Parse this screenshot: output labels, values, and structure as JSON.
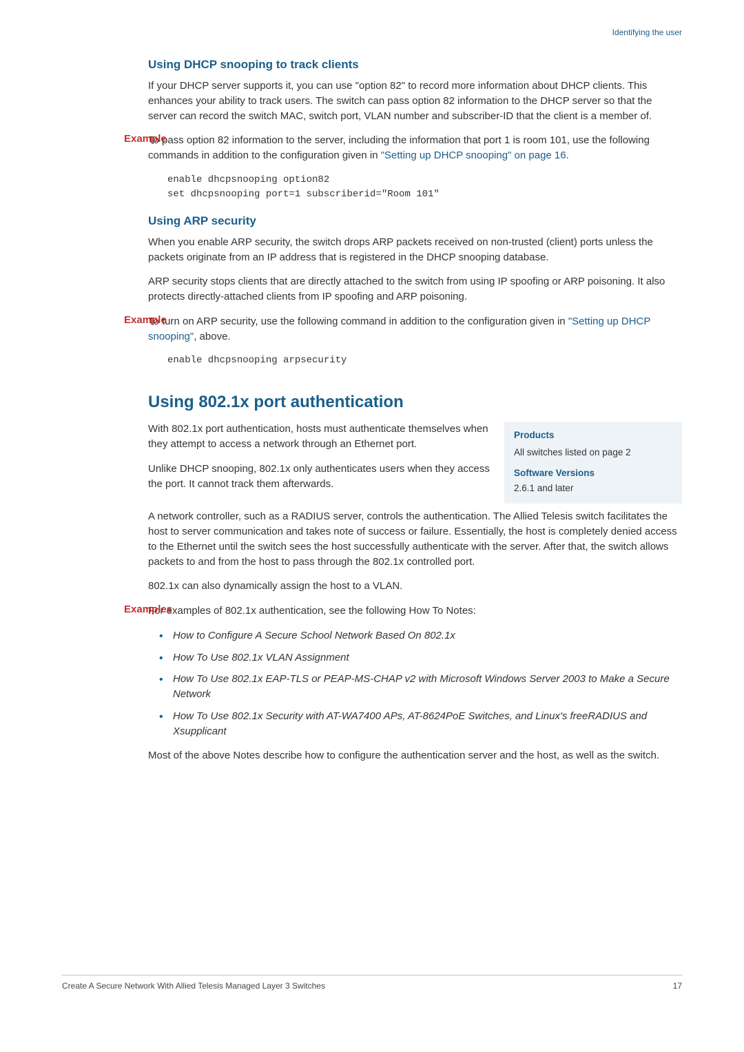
{
  "header": {
    "section": "Identifying the user"
  },
  "section1": {
    "heading": "Using DHCP snooping to track clients",
    "para1": "If your DHCP server supports it, you can use \"option 82\" to record more information about DHCP clients. This enhances your ability to track users. The switch can pass option 82 information to the DHCP server so that the server can record the switch MAC, switch port, VLAN number and subscriber-ID that the client is a member of.",
    "example_label": "Example",
    "example_text_a": "To pass option 82 information to the server, including the information that port 1 is room 101, use the following commands in addition to the configuration given in ",
    "example_link": "\"Setting up DHCP snooping\" on page 16",
    "example_text_b": ".",
    "code1": "enable dhcpsnooping option82",
    "code2": "set dhcpsnooping port=1 subscriberid=\"Room 101\""
  },
  "section2": {
    "heading": "Using ARP security",
    "para1": "When you enable ARP security, the switch drops ARP packets received on non-trusted (client) ports unless the packets originate from an IP address that is registered in the DHCP snooping database.",
    "para2": "ARP security stops clients that are directly attached to the switch from using IP spoofing or ARP poisoning. It also protects directly-attached clients from IP spoofing and ARP poisoning.",
    "example_label": "Example",
    "example_text_a": "To turn on ARP security, use the following command in addition to the configuration given in ",
    "example_link": "\"Setting up DHCP snooping\"",
    "example_text_b": ", above.",
    "code1": "enable dhcpsnooping arpsecurity"
  },
  "section3": {
    "heading": "Using 802.1x port authentication",
    "products": {
      "h1": "Products",
      "l1": "All switches listed on page 2",
      "h2": "Software Versions",
      "l2": "2.6.1 and later"
    },
    "para1": "With 802.1x port authentication, hosts must authenticate themselves when they attempt to access a network through an Ethernet port.",
    "para2": "Unlike DHCP snooping, 802.1x only authenticates users when they access the port. It cannot track them afterwards.",
    "para3": "A network controller, such as a RADIUS server, controls the authentication. The Allied Telesis switch facilitates the host to server communication and takes note of success or failure. Essentially, the host is completely denied access to the Ethernet until the switch sees the host successfully authenticate with the server. After that, the switch allows packets to and from the host to pass through the 802.1x controlled port.",
    "para4": "802.1x can also dynamically assign the host to a VLAN.",
    "examples_label": "Examples",
    "examples_intro": "For examples of 802.1x authentication, see the following How To Notes:",
    "bullets": [
      "How to Configure A Secure School Network Based On 802.1x",
      "How To Use 802.1x VLAN Assignment",
      "How To Use 802.1x EAP-TLS or PEAP-MS-CHAP v2 with Microsoft Windows Server 2003 to Make a Secure Network",
      "How To Use 802.1x Security with AT-WA7400 APs, AT-8624PoE Switches, and Linux's freeRADIUS and Xsupplicant"
    ],
    "para5": "Most of the above Notes describe how to configure the authentication server and the host, as well as the switch."
  },
  "footer": {
    "left": "Create A Secure Network With Allied Telesis Managed Layer 3 Switches",
    "right": "17"
  }
}
